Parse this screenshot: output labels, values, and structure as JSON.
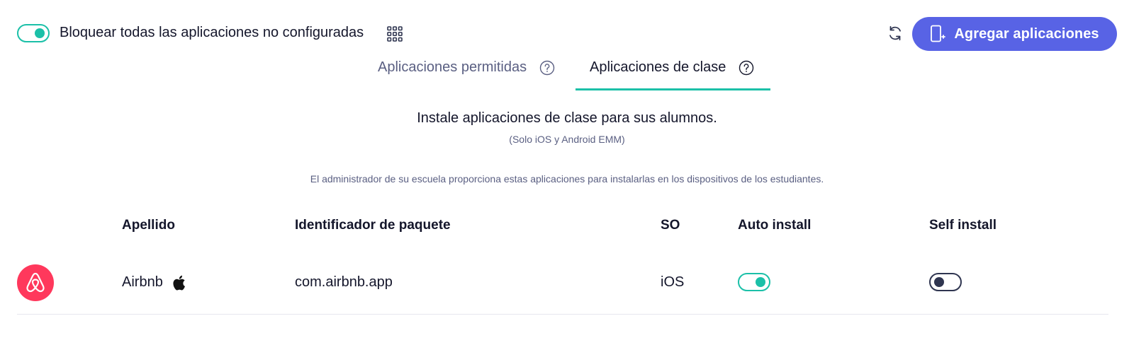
{
  "header": {
    "block_label": "Bloquear todas las aplicaciones no configuradas",
    "block_enabled": true,
    "add_button_label": "Agregar aplicaciones",
    "icons": [
      "grid-icon",
      "refresh-icon",
      "add-device-icon"
    ]
  },
  "tabs": [
    {
      "label": "Aplicaciones permitidas",
      "active": false
    },
    {
      "label": "Aplicaciones de clase",
      "active": true
    }
  ],
  "intro": {
    "title": "Instale aplicaciones de clase para sus alumnos.",
    "subtitle": "(Solo iOS y Android EMM)",
    "description": "El administrador de su escuela proporciona estas aplicaciones para instalarlas en los dispositivos de los estudiantes."
  },
  "table": {
    "columns": [
      "Apellido",
      "Identificador de paquete",
      "SO",
      "Auto install",
      "Self install"
    ],
    "rows": [
      {
        "name": "Airbnb",
        "platform_icon": "apple-icon",
        "bundle_id": "com.airbnb.app",
        "os": "iOS",
        "auto_install": true,
        "self_install": false
      }
    ]
  },
  "colors": {
    "accent": "#1bc0a8",
    "primary_button": "#5863e5",
    "airbnb_brand": "#ff385c",
    "muted_text": "#5a5f82"
  }
}
